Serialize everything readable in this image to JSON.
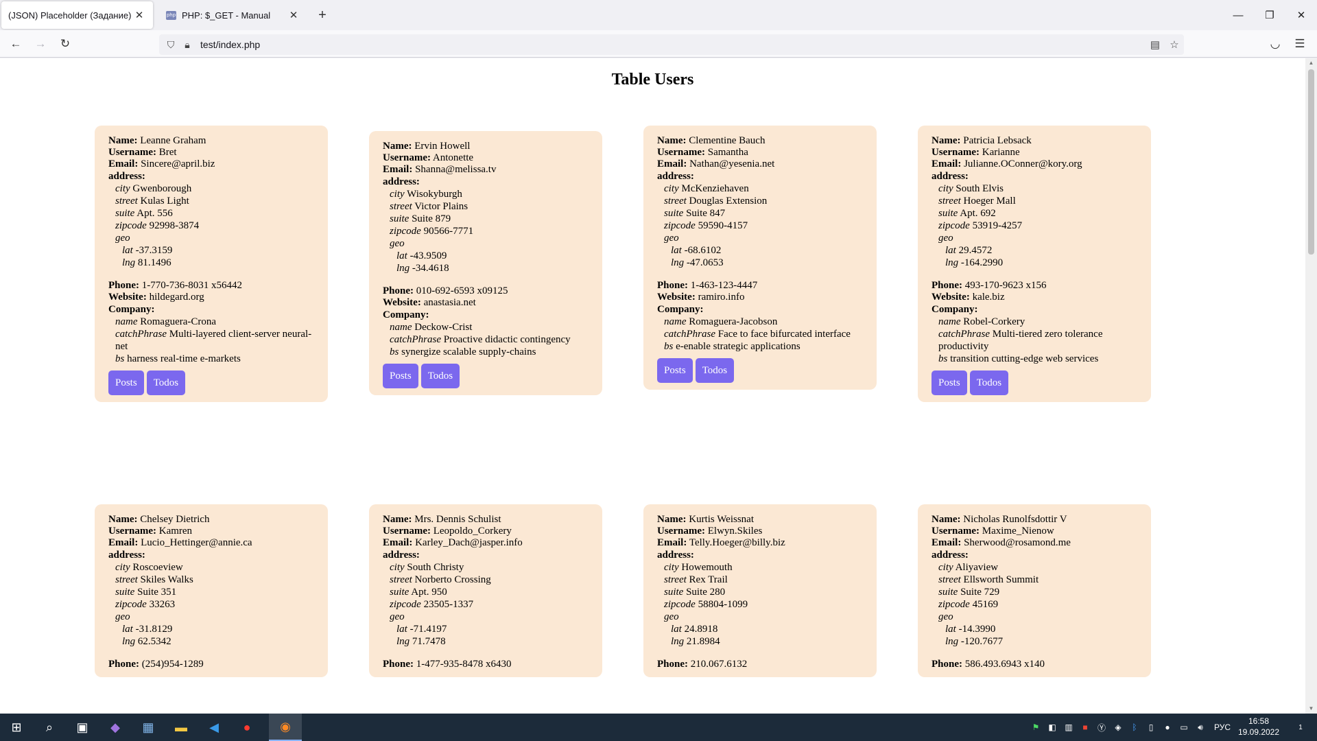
{
  "browser": {
    "tabs": [
      {
        "title": "(JSON) Placeholder (Задание)",
        "close": "✕"
      },
      {
        "title": "PHP: $_GET - Manual",
        "close": "✕",
        "favicon": "php"
      }
    ],
    "new_tab": "+",
    "window": {
      "minimize": "—",
      "restore": "❐",
      "close": "✕"
    },
    "url": "test/index.php"
  },
  "page": {
    "title": "Table Users",
    "labels": {
      "name": "Name:",
      "username": "Username:",
      "email": "Email:",
      "address": "address:",
      "city": "city",
      "street": "street",
      "suite": "suite",
      "zipcode": "zipcode",
      "geo": "geo",
      "lat": "lat",
      "lng": "lng",
      "phone": "Phone:",
      "website": "Website:",
      "company": "Company:",
      "company_name": "name",
      "catchPhrase": "catchPhrase",
      "bs": "bs",
      "posts_button": "Posts",
      "todos_button": "Todos"
    },
    "users": [
      {
        "name": "Leanne Graham",
        "username": "Bret",
        "email": "Sincere@april.biz",
        "address": {
          "city": "Gwenborough",
          "street": "Kulas Light",
          "suite": "Apt. 556",
          "zipcode": "92998-3874",
          "lat": "-37.3159",
          "lng": "81.1496"
        },
        "phone": "1-770-736-8031 x56442",
        "website": "hildegard.org",
        "company": {
          "name": "Romaguera-Crona",
          "catchPhrase": "Multi-layered client-server neural-net",
          "bs": "harness real-time e-markets"
        }
      },
      {
        "name": "Ervin Howell",
        "username": "Antonette",
        "email": "Shanna@melissa.tv",
        "address": {
          "city": "Wisokyburgh",
          "street": "Victor Plains",
          "suite": "Suite 879",
          "zipcode": "90566-7771",
          "lat": "-43.9509",
          "lng": "-34.4618"
        },
        "phone": "010-692-6593 x09125",
        "website": "anastasia.net",
        "company": {
          "name": "Deckow-Crist",
          "catchPhrase": "Proactive didactic contingency",
          "bs": "synergize scalable supply-chains"
        }
      },
      {
        "name": "Clementine Bauch",
        "username": "Samantha",
        "email": "Nathan@yesenia.net",
        "address": {
          "city": "McKenziehaven",
          "street": "Douglas Extension",
          "suite": "Suite 847",
          "zipcode": "59590-4157",
          "lat": "-68.6102",
          "lng": "-47.0653"
        },
        "phone": "1-463-123-4447",
        "website": "ramiro.info",
        "company": {
          "name": "Romaguera-Jacobson",
          "catchPhrase": "Face to face bifurcated interface",
          "bs": "e-enable strategic applications"
        }
      },
      {
        "name": "Patricia Lebsack",
        "username": "Karianne",
        "email": "Julianne.OConner@kory.org",
        "address": {
          "city": "South Elvis",
          "street": "Hoeger Mall",
          "suite": "Apt. 692",
          "zipcode": "53919-4257",
          "lat": "29.4572",
          "lng": "-164.2990"
        },
        "phone": "493-170-9623 x156",
        "website": "kale.biz",
        "company": {
          "name": "Robel-Corkery",
          "catchPhrase": "Multi-tiered zero tolerance productivity",
          "bs": "transition cutting-edge web services"
        }
      },
      {
        "name": "Chelsey Dietrich",
        "username": "Kamren",
        "email": "Lucio_Hettinger@annie.ca",
        "address": {
          "city": "Roscoeview",
          "street": "Skiles Walks",
          "suite": "Suite 351",
          "zipcode": "33263",
          "lat": "-31.8129",
          "lng": "62.5342"
        },
        "phone": "(254)954-1289"
      },
      {
        "name": "Mrs. Dennis Schulist",
        "username": "Leopoldo_Corkery",
        "email": "Karley_Dach@jasper.info",
        "address": {
          "city": "South Christy",
          "street": "Norberto Crossing",
          "suite": "Apt. 950",
          "zipcode": "23505-1337",
          "lat": "-71.4197",
          "lng": "71.7478"
        },
        "phone": "1-477-935-8478 x6430"
      },
      {
        "name": "Kurtis Weissnat",
        "username": "Elwyn.Skiles",
        "email": "Telly.Hoeger@billy.biz",
        "address": {
          "city": "Howemouth",
          "street": "Rex Trail",
          "suite": "Suite 280",
          "zipcode": "58804-1099",
          "lat": "24.8918",
          "lng": "21.8984"
        },
        "phone": "210.067.6132"
      },
      {
        "name": "Nicholas Runolfsdottir V",
        "username": "Maxime_Nienow",
        "email": "Sherwood@rosamond.me",
        "address": {
          "city": "Aliyaview",
          "street": "Ellsworth Summit",
          "suite": "Suite 729",
          "zipcode": "45169",
          "lat": "-14.3990",
          "lng": "-120.7677"
        },
        "phone": "586.493.6943 x140"
      }
    ]
  },
  "taskbar": {
    "language": "РУС",
    "time": "16:58",
    "date": "19.09.2022",
    "notification_count": "1"
  }
}
